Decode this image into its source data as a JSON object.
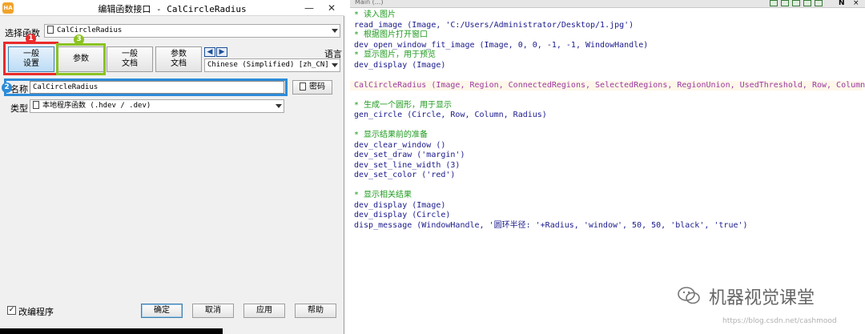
{
  "dialog": {
    "title": "编辑函数接口 - CalCircleRadius",
    "app_icon": "HA",
    "select_label": "选择函数",
    "select_value": "CalCircleRadius",
    "tabs": [
      {
        "line1": "一般",
        "line2": "设置"
      },
      {
        "line1": "参数",
        "line2": ""
      },
      {
        "line1": "一般",
        "line2": "文档"
      },
      {
        "line1": "参数",
        "line2": "文档"
      }
    ],
    "language_label": "语言",
    "language_value": "Chinese (Simplified) [zh_CN]",
    "name_label": "名称",
    "name_value": "CalCircleRadius",
    "password_label": "密码",
    "type_label": "类型",
    "type_value": "本地程序函数 (.hdev / .dev)",
    "checkbox_label": "改编程序",
    "checkbox_checked": true,
    "buttons": {
      "ok": "确定",
      "cancel": "取消",
      "apply": "应用",
      "help": "帮助"
    },
    "badges": [
      "1",
      "2",
      "3"
    ]
  },
  "editor": {
    "tab_label": "Main (...)",
    "corner_n": "N",
    "corner_close": "×",
    "lines": [
      {
        "kind": "comment",
        "text": "* 读入图片"
      },
      {
        "kind": "normal",
        "text": "read_image (Image, 'C:/Users/Administrator/Desktop/1.jpg')"
      },
      {
        "kind": "comment",
        "text": "* 根据图片打开窗口"
      },
      {
        "kind": "normal",
        "text": "dev_open_window_fit_image (Image, 0, 0, -1, -1, WindowHandle)"
      },
      {
        "kind": "comment",
        "text": "* 显示图片，用于预览"
      },
      {
        "kind": "normal",
        "text": "dev_display (Image)"
      },
      {
        "kind": "blank",
        "text": ""
      },
      {
        "kind": "special",
        "text": "CalCircleRadius (Image, Region, ConnectedRegions, SelectedRegions, RegionUnion, UsedThreshold, Row, Column, Radius)"
      },
      {
        "kind": "blank",
        "text": ""
      },
      {
        "kind": "comment",
        "text": "* 生成一个圆形，用于显示"
      },
      {
        "kind": "normal",
        "text": "gen_circle (Circle, Row, Column, Radius)"
      },
      {
        "kind": "blank",
        "text": ""
      },
      {
        "kind": "comment",
        "text": "* 显示结果前的准备"
      },
      {
        "kind": "normal",
        "text": "dev_clear_window ()"
      },
      {
        "kind": "normal",
        "text": "dev_set_draw ('margin')"
      },
      {
        "kind": "normal",
        "text": "dev_set_line_width (3)"
      },
      {
        "kind": "normal",
        "text": "dev_set_color ('red')"
      },
      {
        "kind": "blank",
        "text": ""
      },
      {
        "kind": "comment",
        "text": "* 显示相关结果"
      },
      {
        "kind": "normal",
        "text": "dev_display (Image)"
      },
      {
        "kind": "normal",
        "text": "dev_display (Circle)"
      },
      {
        "kind": "normal",
        "text": "disp_message (WindowHandle, '圆环半径: '+Radius, 'window', 50, 50, 'black', 'true')"
      }
    ]
  },
  "watermark": {
    "text": "机器视觉课堂",
    "url": "https://blog.csdn.net/cashmood"
  }
}
